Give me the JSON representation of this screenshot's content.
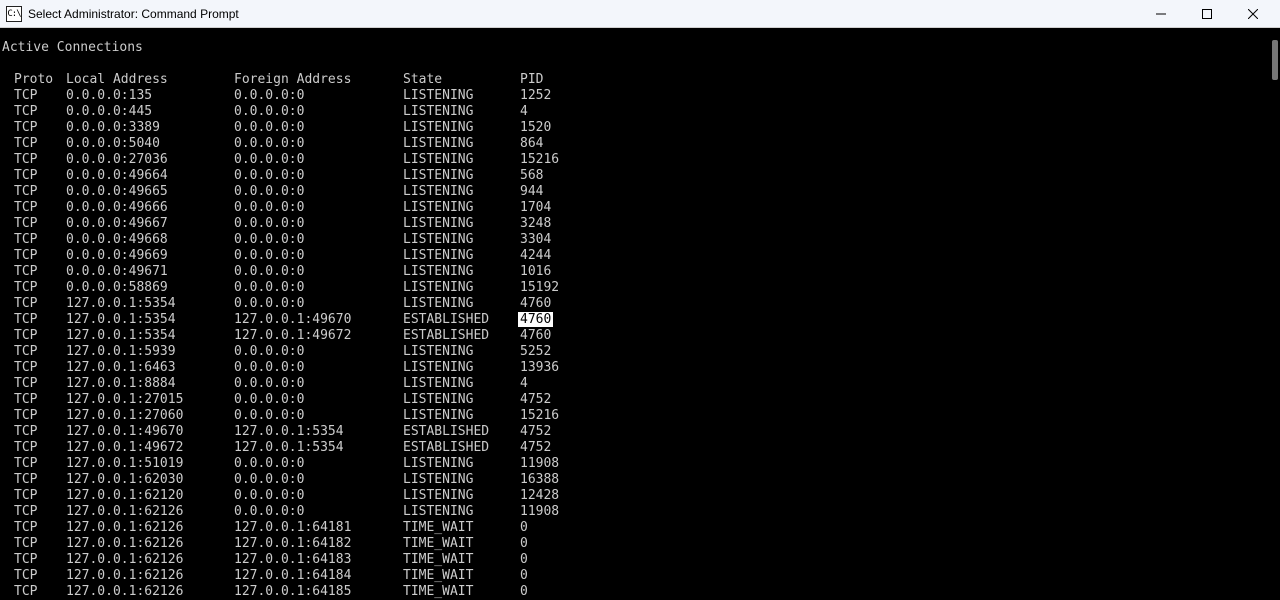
{
  "window": {
    "icon_text": "C:\\",
    "title": "Select Administrator: Command Prompt"
  },
  "terminal": {
    "heading": "Active Connections",
    "columns": {
      "proto": "Proto",
      "local": "Local Address",
      "foreign": "Foreign Address",
      "state": "State",
      "pid": "PID"
    },
    "rows": [
      {
        "proto": "TCP",
        "local": "0.0.0.0:135",
        "foreign": "0.0.0.0:0",
        "state": "LISTENING",
        "pid": "1252"
      },
      {
        "proto": "TCP",
        "local": "0.0.0.0:445",
        "foreign": "0.0.0.0:0",
        "state": "LISTENING",
        "pid": "4"
      },
      {
        "proto": "TCP",
        "local": "0.0.0.0:3389",
        "foreign": "0.0.0.0:0",
        "state": "LISTENING",
        "pid": "1520"
      },
      {
        "proto": "TCP",
        "local": "0.0.0.0:5040",
        "foreign": "0.0.0.0:0",
        "state": "LISTENING",
        "pid": "864"
      },
      {
        "proto": "TCP",
        "local": "0.0.0.0:27036",
        "foreign": "0.0.0.0:0",
        "state": "LISTENING",
        "pid": "15216"
      },
      {
        "proto": "TCP",
        "local": "0.0.0.0:49664",
        "foreign": "0.0.0.0:0",
        "state": "LISTENING",
        "pid": "568"
      },
      {
        "proto": "TCP",
        "local": "0.0.0.0:49665",
        "foreign": "0.0.0.0:0",
        "state": "LISTENING",
        "pid": "944"
      },
      {
        "proto": "TCP",
        "local": "0.0.0.0:49666",
        "foreign": "0.0.0.0:0",
        "state": "LISTENING",
        "pid": "1704"
      },
      {
        "proto": "TCP",
        "local": "0.0.0.0:49667",
        "foreign": "0.0.0.0:0",
        "state": "LISTENING",
        "pid": "3248"
      },
      {
        "proto": "TCP",
        "local": "0.0.0.0:49668",
        "foreign": "0.0.0.0:0",
        "state": "LISTENING",
        "pid": "3304"
      },
      {
        "proto": "TCP",
        "local": "0.0.0.0:49669",
        "foreign": "0.0.0.0:0",
        "state": "LISTENING",
        "pid": "4244"
      },
      {
        "proto": "TCP",
        "local": "0.0.0.0:49671",
        "foreign": "0.0.0.0:0",
        "state": "LISTENING",
        "pid": "1016"
      },
      {
        "proto": "TCP",
        "local": "0.0.0.0:58869",
        "foreign": "0.0.0.0:0",
        "state": "LISTENING",
        "pid": "15192"
      },
      {
        "proto": "TCP",
        "local": "127.0.0.1:5354",
        "foreign": "0.0.0.0:0",
        "state": "LISTENING",
        "pid": "4760"
      },
      {
        "proto": "TCP",
        "local": "127.0.0.1:5354",
        "foreign": "127.0.0.1:49670",
        "state": "ESTABLISHED",
        "pid": "4760",
        "selected": true
      },
      {
        "proto": "TCP",
        "local": "127.0.0.1:5354",
        "foreign": "127.0.0.1:49672",
        "state": "ESTABLISHED",
        "pid": "4760"
      },
      {
        "proto": "TCP",
        "local": "127.0.0.1:5939",
        "foreign": "0.0.0.0:0",
        "state": "LISTENING",
        "pid": "5252"
      },
      {
        "proto": "TCP",
        "local": "127.0.0.1:6463",
        "foreign": "0.0.0.0:0",
        "state": "LISTENING",
        "pid": "13936"
      },
      {
        "proto": "TCP",
        "local": "127.0.0.1:8884",
        "foreign": "0.0.0.0:0",
        "state": "LISTENING",
        "pid": "4"
      },
      {
        "proto": "TCP",
        "local": "127.0.0.1:27015",
        "foreign": "0.0.0.0:0",
        "state": "LISTENING",
        "pid": "4752"
      },
      {
        "proto": "TCP",
        "local": "127.0.0.1:27060",
        "foreign": "0.0.0.0:0",
        "state": "LISTENING",
        "pid": "15216"
      },
      {
        "proto": "TCP",
        "local": "127.0.0.1:49670",
        "foreign": "127.0.0.1:5354",
        "state": "ESTABLISHED",
        "pid": "4752"
      },
      {
        "proto": "TCP",
        "local": "127.0.0.1:49672",
        "foreign": "127.0.0.1:5354",
        "state": "ESTABLISHED",
        "pid": "4752"
      },
      {
        "proto": "TCP",
        "local": "127.0.0.1:51019",
        "foreign": "0.0.0.0:0",
        "state": "LISTENING",
        "pid": "11908"
      },
      {
        "proto": "TCP",
        "local": "127.0.0.1:62030",
        "foreign": "0.0.0.0:0",
        "state": "LISTENING",
        "pid": "16388"
      },
      {
        "proto": "TCP",
        "local": "127.0.0.1:62120",
        "foreign": "0.0.0.0:0",
        "state": "LISTENING",
        "pid": "12428"
      },
      {
        "proto": "TCP",
        "local": "127.0.0.1:62126",
        "foreign": "0.0.0.0:0",
        "state": "LISTENING",
        "pid": "11908"
      },
      {
        "proto": "TCP",
        "local": "127.0.0.1:62126",
        "foreign": "127.0.0.1:64181",
        "state": "TIME_WAIT",
        "pid": "0"
      },
      {
        "proto": "TCP",
        "local": "127.0.0.1:62126",
        "foreign": "127.0.0.1:64182",
        "state": "TIME_WAIT",
        "pid": "0"
      },
      {
        "proto": "TCP",
        "local": "127.0.0.1:62126",
        "foreign": "127.0.0.1:64183",
        "state": "TIME_WAIT",
        "pid": "0"
      },
      {
        "proto": "TCP",
        "local": "127.0.0.1:62126",
        "foreign": "127.0.0.1:64184",
        "state": "TIME_WAIT",
        "pid": "0"
      },
      {
        "proto": "TCP",
        "local": "127.0.0.1:62126",
        "foreign": "127.0.0.1:64185",
        "state": "TIME_WAIT",
        "pid": "0"
      }
    ]
  }
}
